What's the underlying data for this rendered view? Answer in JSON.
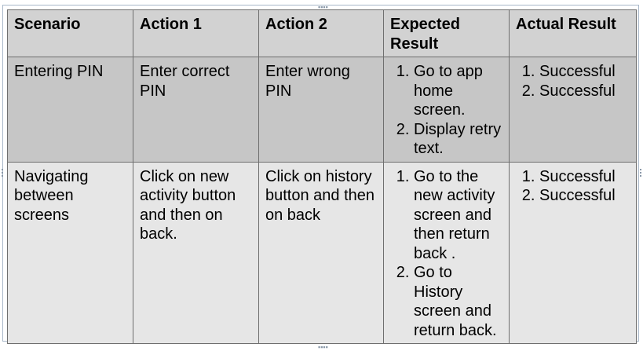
{
  "table": {
    "headers": [
      "Scenario",
      "Action 1",
      "Action 2",
      "Expected Result",
      "Actual Result"
    ],
    "rows": [
      {
        "scenario": "Entering PIN",
        "action1": "Enter correct PIN",
        "action2": "Enter wrong PIN",
        "expected": [
          "Go to app home screen.",
          "Display retry text."
        ],
        "actual": [
          "Successful",
          "Successful"
        ]
      },
      {
        "scenario": "Navigating between screens",
        "action1": "Click on new activity button and then on back.",
        "action2": "Click on history button and then on back",
        "expected": [
          "Go to the new activity screen and then return back .",
          "Go to History screen and return back."
        ],
        "actual": [
          "Successful",
          "Successful"
        ]
      }
    ]
  }
}
